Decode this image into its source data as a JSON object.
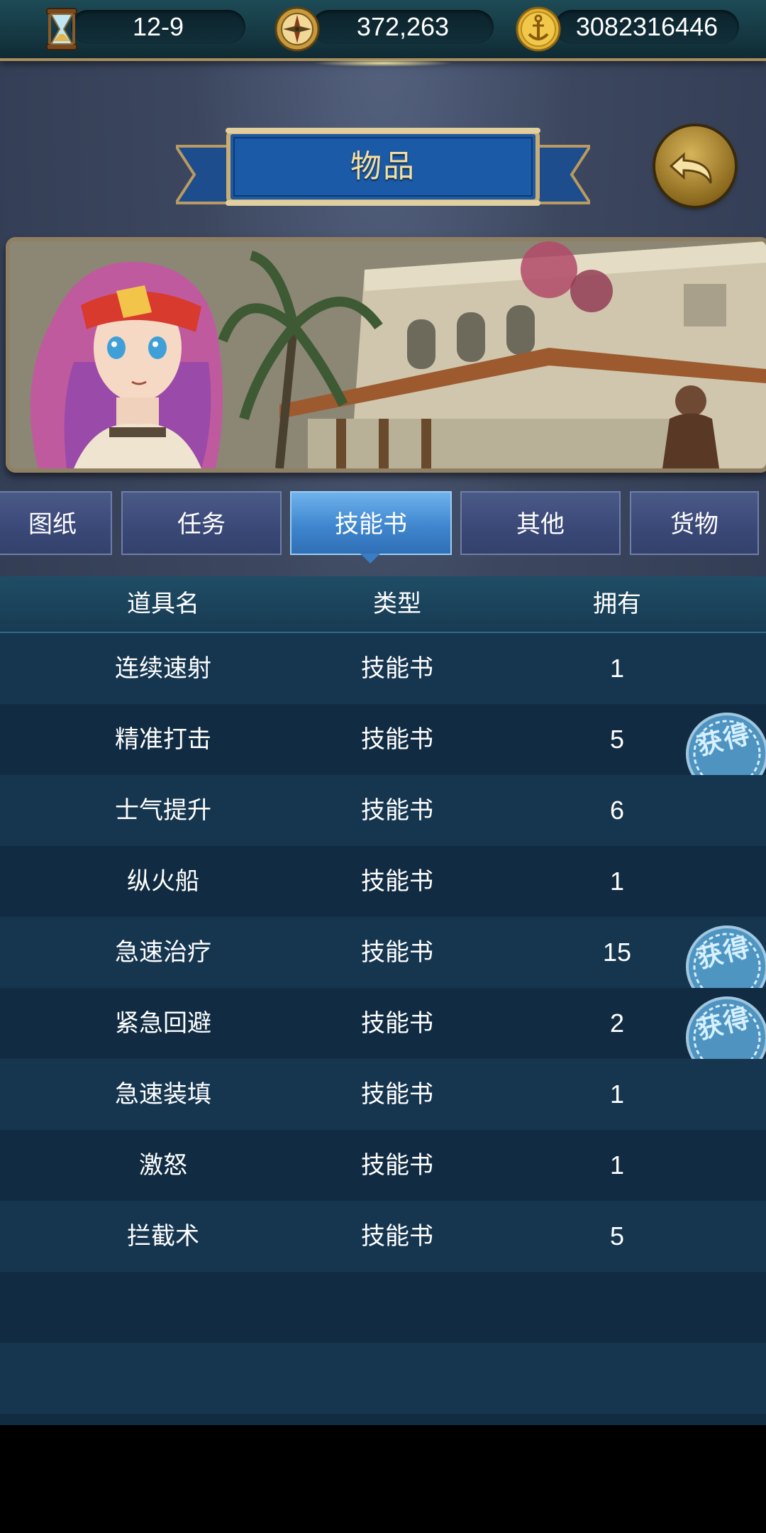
{
  "topbar": {
    "stats": [
      {
        "icon": "hourglass-icon",
        "value": "12-9"
      },
      {
        "icon": "compass-icon",
        "value": "372,263"
      },
      {
        "icon": "anchor-coin-icon",
        "value": "3082316446"
      }
    ]
  },
  "title": "物品",
  "back_icon": "back-arrow-icon",
  "tabs": [
    {
      "label": "图纸",
      "active": false
    },
    {
      "label": "任务",
      "active": false
    },
    {
      "label": "技能书",
      "active": true
    },
    {
      "label": "其他",
      "active": false
    },
    {
      "label": "货物",
      "active": false
    }
  ],
  "table": {
    "headers": [
      "道具名",
      "类型",
      "拥有"
    ],
    "rows": [
      {
        "name": "连续速射",
        "type": "技能书",
        "count": "1",
        "stamp": ""
      },
      {
        "name": "精准打击",
        "type": "技能书",
        "count": "5",
        "stamp": "获得"
      },
      {
        "name": "士气提升",
        "type": "技能书",
        "count": "6",
        "stamp": ""
      },
      {
        "name": "纵火船",
        "type": "技能书",
        "count": "1",
        "stamp": ""
      },
      {
        "name": "急速治疗",
        "type": "技能书",
        "count": "15",
        "stamp": "获得"
      },
      {
        "name": "紧急回避",
        "type": "技能书",
        "count": "2",
        "stamp": "获得"
      },
      {
        "name": "急速装填",
        "type": "技能书",
        "count": "1",
        "stamp": ""
      },
      {
        "name": "激怒",
        "type": "技能书",
        "count": "1",
        "stamp": ""
      },
      {
        "name": "拦截术",
        "type": "技能书",
        "count": "5",
        "stamp": ""
      }
    ]
  },
  "colors": {
    "accent_gold": "#f3dfa3",
    "active_tab": "#3f86cf",
    "inactive_tab": "#3a4877",
    "table_bg": "#112b40"
  }
}
